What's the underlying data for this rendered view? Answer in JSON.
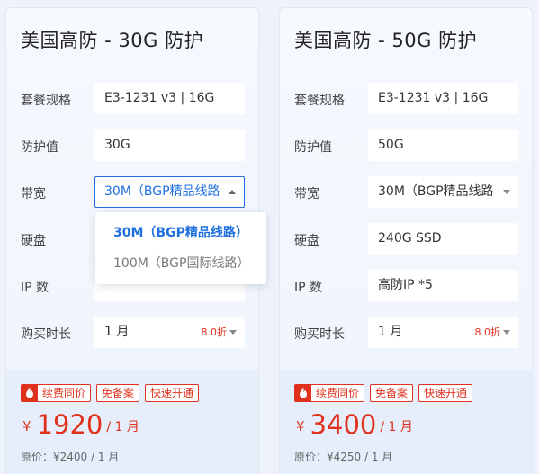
{
  "cards": [
    {
      "title": "美国高防 - 30G 防护",
      "rows": [
        {
          "label": "套餐规格",
          "value": "E3-1231 v3 | 16G"
        },
        {
          "label": "防护值",
          "value": "30G"
        },
        {
          "label": "带宽",
          "value": "30M（BGP精品线路"
        },
        {
          "label": "硬盘",
          "value": ""
        },
        {
          "label": "IP 数",
          "value": ""
        },
        {
          "label": "购买时长",
          "value": "1 月",
          "discount": "8.0折"
        }
      ],
      "bandwidth_dropdown": {
        "open": true,
        "options": [
          "30M（BGP精品线路）",
          "100M（BGP国际线路）"
        ],
        "selected_index": 0
      },
      "tags": [
        "续费同价",
        "免备案",
        "快速开通"
      ],
      "price": {
        "currency": "¥",
        "amount": "1920",
        "period": "/ 1 月"
      },
      "original_price": "原价：¥2400 / 1 月"
    },
    {
      "title": "美国高防 - 50G 防护",
      "rows": [
        {
          "label": "套餐规格",
          "value": "E3-1231 v3 | 16G"
        },
        {
          "label": "防护值",
          "value": "50G"
        },
        {
          "label": "带宽",
          "value": "30M（BGP精品线路"
        },
        {
          "label": "硬盘",
          "value": "240G SSD"
        },
        {
          "label": "IP 数",
          "value": "高防IP *5"
        },
        {
          "label": "购买时长",
          "value": "1 月",
          "discount": "8.0折"
        }
      ],
      "tags": [
        "续费同价",
        "免备案",
        "快速开通"
      ],
      "price": {
        "currency": "¥",
        "amount": "3400",
        "period": "/ 1 月"
      },
      "original_price": "原价：¥4250 / 1 月"
    }
  ],
  "colors": {
    "accent": "#1f6fe0",
    "price_red": "#e0301e",
    "card_bg": "#f6f9fe",
    "page_bg": "#eef3fb"
  },
  "icons": {
    "tag_hot": "fire-icon",
    "select_caret": "caret-down-icon",
    "select_caret_open": "caret-up-icon"
  }
}
